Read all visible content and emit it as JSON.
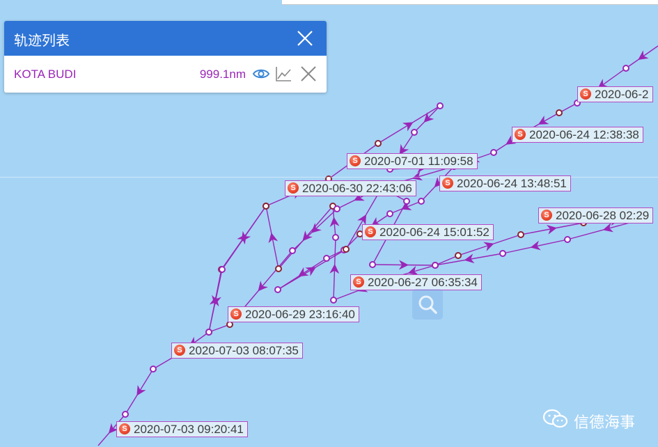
{
  "colors": {
    "sea": "#a6d4f5",
    "track": "#9a25b7",
    "header": "#2e74d6",
    "point_dark": "#8a2233",
    "label_border": "#b44ac4"
  },
  "panel": {
    "title": "轨迹列表",
    "close_icon": "close-icon",
    "tracks": [
      {
        "ship_name": "KOTA BUDI",
        "distance": "999.1nm",
        "icons": [
          "eye-icon",
          "line-chart-icon",
          "remove-icon"
        ]
      }
    ]
  },
  "time_labels": [
    {
      "text": "2020-06-2"
    },
    {
      "text": "2020-06-24 12:38:38"
    },
    {
      "text": "2020-07-01 11:09:58"
    },
    {
      "text": "2020-06-24 13:48:51"
    },
    {
      "text": "2020-06-30 22:43:06"
    },
    {
      "text": "2020-06-28 02:29"
    },
    {
      "text": "2020-06-24 15:01:52"
    },
    {
      "text": "2020-06-27 06:35:34"
    },
    {
      "text": "2020-06-29 23:16:40"
    },
    {
      "text": "2020-07-03 08:07:35"
    },
    {
      "text": "2020-07-03 09:20:41"
    }
  ],
  "label_badge": "S",
  "search_icon": "magnifier-icon",
  "watermark": {
    "icon": "wechat-icon",
    "text": "信德海事"
  }
}
